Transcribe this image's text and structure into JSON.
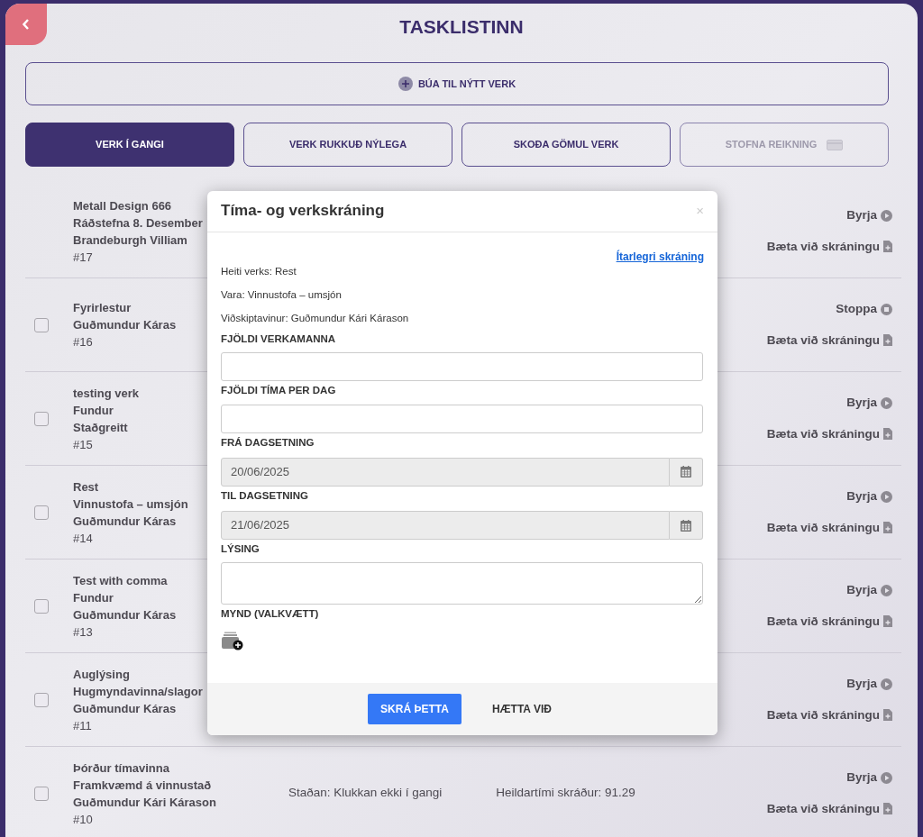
{
  "page": {
    "title": "TASKLISTINN"
  },
  "create_button": {
    "label": "BÚA TIL NÝTT VERK"
  },
  "tabs": [
    {
      "kind": "list",
      "label": "VERK Í GANGI",
      "selected": true,
      "disabled": false
    },
    {
      "kind": "list",
      "label": "VERK RUKKUÐ NÝLEGA",
      "selected": false,
      "disabled": false
    },
    {
      "kind": "list",
      "label": "SKOÐA GÖMUL VERK",
      "selected": false,
      "disabled": false
    },
    {
      "kind": "invoice",
      "label": "STOFNA REIKNING",
      "selected": false,
      "disabled": true
    }
  ],
  "tasks": [
    {
      "lines": [
        "Metall Design 666",
        "Ráðstefna 8. Desember",
        "Brandeburgh Villiam"
      ],
      "number": "#17",
      "action": {
        "kind": "start",
        "label": "Byrja"
      },
      "add_label": "Bæta við skráningu"
    },
    {
      "lines": [
        "Fyrirlestur",
        "Guðmundur Káras"
      ],
      "number": "#16",
      "checked": false,
      "action": {
        "kind": "stop",
        "label": "Stoppa"
      },
      "add_label": "Bæta við skráningu"
    },
    {
      "lines": [
        "testing verk",
        "Fundur",
        "Staðgreitt"
      ],
      "number": "#15",
      "checked": false,
      "action": {
        "kind": "start",
        "label": "Byrja"
      },
      "add_label": "Bæta við skráningu"
    },
    {
      "lines": [
        "Rest",
        "Vinnustofa – umsjón",
        "Guðmundur Káras"
      ],
      "number": "#14",
      "checked": false,
      "action": {
        "kind": "start",
        "label": "Byrja"
      },
      "add_label": "Bæta við skráningu"
    },
    {
      "lines": [
        "Test with comma",
        "Fundur",
        "Guðmundur Káras"
      ],
      "number": "#13",
      "checked": false,
      "action": {
        "kind": "start",
        "label": "Byrja"
      },
      "add_label": "Bæta við skráningu"
    },
    {
      "lines": [
        "Auglýsing",
        "Hugmyndavinna/slagor",
        "Guðmundur Káras"
      ],
      "number": "#11",
      "checked": false,
      "action": {
        "kind": "start",
        "label": "Byrja"
      },
      "add_label": "Bæta við skráningu"
    },
    {
      "lines": [
        "Þórður tímavinna",
        "Framkvæmd á vinnustað",
        "Guðmundur Kári Kárason"
      ],
      "number": "#10",
      "checked": false,
      "status": "Staðan: Klukkan ekki í gangi",
      "total": "Heildartími skráður: 91.29",
      "action": {
        "kind": "start",
        "label": "Byrja"
      },
      "add_label": "Bæta við skráningu"
    }
  ],
  "modal": {
    "title": "Tíma- og verkskráning",
    "close": "×",
    "link": "Ítarlegri skráning",
    "info": [
      "Heiti verks: Rest",
      "Vara: Vinnustofa – umsjón",
      "Viðskiptavinur: Guðmundur Kári Kárason"
    ],
    "fields": [
      {
        "kind": "text",
        "label": "FJÖLDI VERKAMANNA"
      },
      {
        "kind": "text",
        "label": "FJÖLDI TÍMA PER DAG"
      },
      {
        "kind": "date",
        "label": "FRÁ DAGSETNING",
        "value": "20/06/2025"
      },
      {
        "kind": "date",
        "label": "TIL DAGSETNING",
        "value": "21/06/2025"
      },
      {
        "kind": "textarea",
        "label": "LÝSING"
      },
      {
        "kind": "image",
        "label": "MYND (VALKVÆTT)"
      }
    ],
    "buttons": [
      {
        "kind": "primary",
        "label": "SKRÁ ÞETTA"
      },
      {
        "kind": "plain",
        "label": "HÆTTA VIÐ"
      }
    ]
  }
}
